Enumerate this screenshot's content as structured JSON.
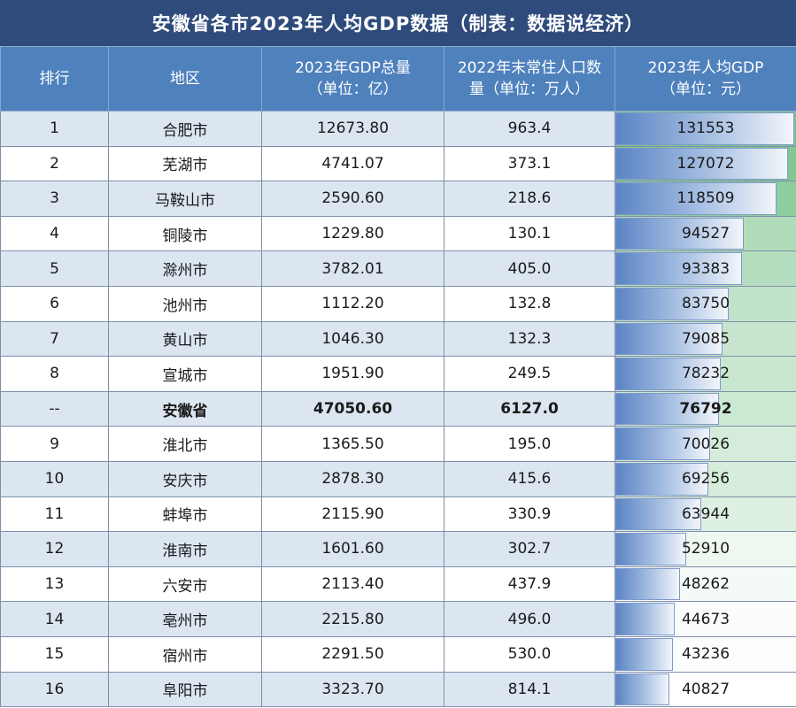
{
  "title": "安徽省各市2023年人均GDP数据（制表：数据说经济）",
  "headers": {
    "rank": "排行",
    "region": "地区",
    "gdp_line1": "2023年GDP总量",
    "gdp_line2": "（单位：亿）",
    "pop_line1": "2022年末常住人口数",
    "pop_line2": "量（单位：万人）",
    "pcgdp_line1": "2023年人均GDP",
    "pcgdp_line2": "（单位：元）"
  },
  "colors": {
    "title_bg": "#2f4b7c",
    "header_bg": "#4f81bd",
    "row_shade": "#dce6f1",
    "bar_blue": "#5b84c4",
    "green_high": "#7cc48e"
  },
  "rows": [
    {
      "rank": "1",
      "region": "合肥市",
      "gdp": "12673.80",
      "pop": "963.4",
      "pcgdp": "131553",
      "pcgdp_value": 131553,
      "bold": false
    },
    {
      "rank": "2",
      "region": "芜湖市",
      "gdp": "4741.07",
      "pop": "373.1",
      "pcgdp": "127072",
      "pcgdp_value": 127072,
      "bold": false
    },
    {
      "rank": "3",
      "region": "马鞍山市",
      "gdp": "2590.60",
      "pop": "218.6",
      "pcgdp": "118509",
      "pcgdp_value": 118509,
      "bold": false
    },
    {
      "rank": "4",
      "region": "铜陵市",
      "gdp": "1229.80",
      "pop": "130.1",
      "pcgdp": "94527",
      "pcgdp_value": 94527,
      "bold": false
    },
    {
      "rank": "5",
      "region": "滁州市",
      "gdp": "3782.01",
      "pop": "405.0",
      "pcgdp": "93383",
      "pcgdp_value": 93383,
      "bold": false
    },
    {
      "rank": "6",
      "region": "池州市",
      "gdp": "1112.20",
      "pop": "132.8",
      "pcgdp": "83750",
      "pcgdp_value": 83750,
      "bold": false
    },
    {
      "rank": "7",
      "region": "黄山市",
      "gdp": "1046.30",
      "pop": "132.3",
      "pcgdp": "79085",
      "pcgdp_value": 79085,
      "bold": false
    },
    {
      "rank": "8",
      "region": "宣城市",
      "gdp": "1951.90",
      "pop": "249.5",
      "pcgdp": "78232",
      "pcgdp_value": 78232,
      "bold": false
    },
    {
      "rank": "--",
      "region": "安徽省",
      "gdp": "47050.60",
      "pop": "6127.0",
      "pcgdp": "76792",
      "pcgdp_value": 76792,
      "bold": true
    },
    {
      "rank": "9",
      "region": "淮北市",
      "gdp": "1365.50",
      "pop": "195.0",
      "pcgdp": "70026",
      "pcgdp_value": 70026,
      "bold": false
    },
    {
      "rank": "10",
      "region": "安庆市",
      "gdp": "2878.30",
      "pop": "415.6",
      "pcgdp": "69256",
      "pcgdp_value": 69256,
      "bold": false
    },
    {
      "rank": "11",
      "region": "蚌埠市",
      "gdp": "2115.90",
      "pop": "330.9",
      "pcgdp": "63944",
      "pcgdp_value": 63944,
      "bold": false
    },
    {
      "rank": "12",
      "region": "淮南市",
      "gdp": "1601.60",
      "pop": "302.7",
      "pcgdp": "52910",
      "pcgdp_value": 52910,
      "bold": false
    },
    {
      "rank": "13",
      "region": "六安市",
      "gdp": "2113.40",
      "pop": "437.9",
      "pcgdp": "48262",
      "pcgdp_value": 48262,
      "bold": false
    },
    {
      "rank": "14",
      "region": "亳州市",
      "gdp": "2215.80",
      "pop": "496.0",
      "pcgdp": "44673",
      "pcgdp_value": 44673,
      "bold": false
    },
    {
      "rank": "15",
      "region": "宿州市",
      "gdp": "2291.50",
      "pop": "530.0",
      "pcgdp": "43236",
      "pcgdp_value": 43236,
      "bold": false
    },
    {
      "rank": "16",
      "region": "阜阳市",
      "gdp": "3323.70",
      "pop": "814.1",
      "pcgdp": "40827",
      "pcgdp_value": 40827,
      "bold": false
    }
  ]
}
